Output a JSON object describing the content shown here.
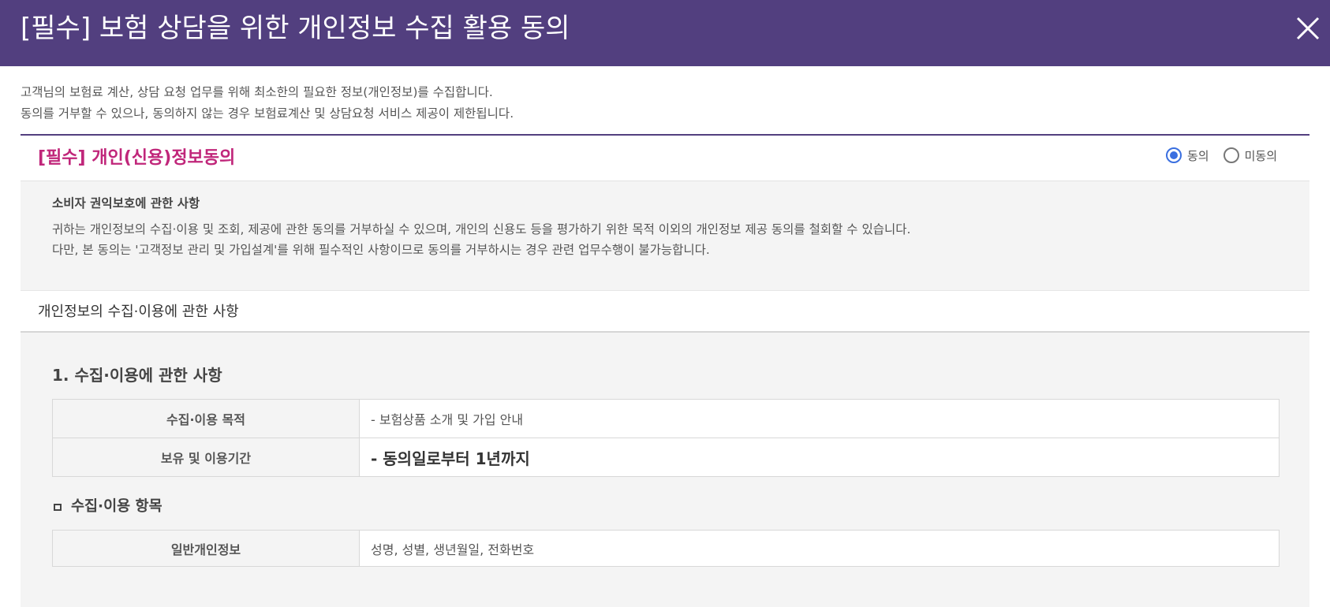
{
  "header": {
    "title": "[필수] 보험 상담을 위한 개인정보 수집 활용 동의",
    "close_icon": "close-icon"
  },
  "intro": {
    "line1": "고객님의 보험료 계산, 상담 요청 업무를 위해 최소한의 필요한 정보(개인정보)를 수집합니다.",
    "line2": "동의를 거부할 수 있으나, 동의하지 않는 경우 보험료계산 및 상담요청 서비스 제공이 제한됩니다."
  },
  "consent": {
    "title": "[필수] 개인(신용)정보동의",
    "options": [
      {
        "label": "동의",
        "checked": true
      },
      {
        "label": "미동의",
        "checked": false
      }
    ]
  },
  "rights": {
    "title": "소비자 권익보호에 관한 사항",
    "line1": "귀하는 개인정보의 수집·이용 및 조회, 제공에 관한 동의를 거부하실 수 있으며, 개인의 신용도 등을 평가하기 위한 목적 이외의 개인정보 제공 동의를 철회할 수 있습니다.",
    "line2": "다만, 본 동의는 '고객정보 관리 및 가입설계'를 위해 필수적인 사항이므로 동의를 거부하시는 경우 관련 업무수행이 불가능합니다."
  },
  "collection": {
    "section_title": "개인정보의 수집·이용에 관한 사항",
    "heading": "1. 수집·이용에 관한 사항",
    "rows": [
      {
        "label": "수집·이용 목적",
        "value": "- 보험상품 소개 및 가입 안내"
      },
      {
        "label": "보유 및 이용기간",
        "value": "- 동의일로부터 1년까지"
      }
    ],
    "items_heading": "수집·이용 항목",
    "items": [
      {
        "label": "일반개인정보",
        "value": "성명, 성별, 생년월일, 전화번호"
      }
    ]
  },
  "colors": {
    "header_bg": "#523f7f",
    "consent_title": "#c0267a",
    "radio_checked": "#3a6fe0"
  }
}
